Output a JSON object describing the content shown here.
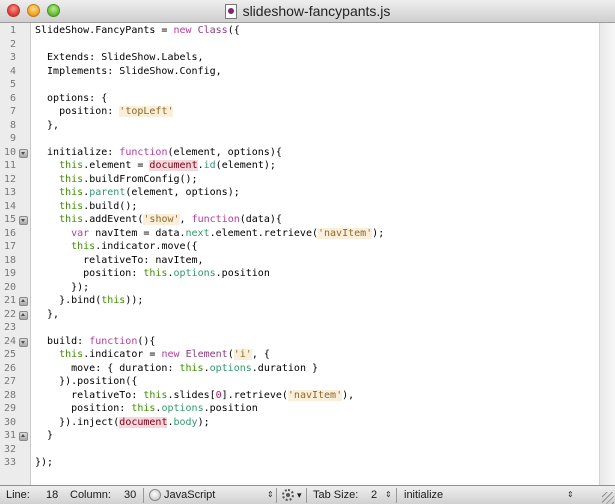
{
  "window": {
    "title": "slideshow-fancypants.js",
    "icon": "javascript-file-icon"
  },
  "editor": {
    "line_numbers": [
      "1",
      "2",
      "3",
      "4",
      "5",
      "6",
      "7",
      "8",
      "9",
      "10",
      "11",
      "12",
      "13",
      "14",
      "15",
      "16",
      "17",
      "18",
      "19",
      "20",
      "21",
      "22",
      "23",
      "24",
      "25",
      "26",
      "27",
      "28",
      "29",
      "30",
      "31",
      "32",
      "33"
    ],
    "fold_markers": [
      {
        "line": "10",
        "direction": "down"
      },
      {
        "line": "15",
        "direction": "down"
      },
      {
        "line": "21",
        "direction": "up"
      },
      {
        "line": "22",
        "direction": "up"
      },
      {
        "line": "24",
        "direction": "down"
      },
      {
        "line": "31",
        "direction": "up"
      }
    ],
    "lines": [
      [
        [
          "SlideShow.FancyPants = ",
          ""
        ],
        [
          "new",
          "kw"
        ],
        [
          " ",
          ""
        ],
        [
          "Class",
          "cls"
        ],
        [
          "({",
          ""
        ]
      ],
      [],
      [
        [
          "  Extends: SlideShow.Labels,",
          ""
        ]
      ],
      [
        [
          "  Implements: SlideShow.Config,",
          ""
        ]
      ],
      [],
      [
        [
          "  options: {",
          ""
        ]
      ],
      [
        [
          "    position: ",
          ""
        ],
        [
          "'topLeft'",
          "str"
        ]
      ],
      [
        [
          "  },",
          ""
        ]
      ],
      [],
      [
        [
          "  initialize: ",
          ""
        ],
        [
          "function",
          "kw"
        ],
        [
          "(element, options){",
          ""
        ]
      ],
      [
        [
          "    ",
          ""
        ],
        [
          "this",
          "this"
        ],
        [
          ".element = ",
          ""
        ],
        [
          "document",
          "glob"
        ],
        [
          ".",
          ""
        ],
        [
          "id",
          "prop"
        ],
        [
          "(element);",
          ""
        ]
      ],
      [
        [
          "    ",
          ""
        ],
        [
          "this",
          "this"
        ],
        [
          ".buildFromConfig();",
          ""
        ]
      ],
      [
        [
          "    ",
          ""
        ],
        [
          "this",
          "this"
        ],
        [
          ".",
          ""
        ],
        [
          "parent",
          "prop"
        ],
        [
          "(element, options);",
          ""
        ]
      ],
      [
        [
          "    ",
          ""
        ],
        [
          "this",
          "this"
        ],
        [
          ".build();",
          ""
        ]
      ],
      [
        [
          "    ",
          ""
        ],
        [
          "this",
          "this"
        ],
        [
          ".addEvent(",
          ""
        ],
        [
          "'show'",
          "str"
        ],
        [
          ", ",
          ""
        ],
        [
          "function",
          "kw"
        ],
        [
          "(data){",
          ""
        ]
      ],
      [
        [
          "      ",
          ""
        ],
        [
          "var",
          "kw"
        ],
        [
          " navItem = data.",
          ""
        ],
        [
          "next",
          "prop"
        ],
        [
          ".element.retrieve(",
          ""
        ],
        [
          "'navItem'",
          "str"
        ],
        [
          ");",
          ""
        ]
      ],
      [
        [
          "      ",
          ""
        ],
        [
          "this",
          "this"
        ],
        [
          ".indicator.move({",
          ""
        ]
      ],
      [
        [
          "        relativeTo: navItem,",
          ""
        ]
      ],
      [
        [
          "        position: ",
          ""
        ],
        [
          "this",
          "this"
        ],
        [
          ".",
          ""
        ],
        [
          "options",
          "prop"
        ],
        [
          ".position",
          ""
        ]
      ],
      [
        [
          "      });",
          ""
        ]
      ],
      [
        [
          "    }.bind(",
          ""
        ],
        [
          "this",
          "this"
        ],
        [
          "));",
          ""
        ]
      ],
      [
        [
          "  },",
          ""
        ]
      ],
      [],
      [
        [
          "  build: ",
          ""
        ],
        [
          "function",
          "kw"
        ],
        [
          "(){",
          ""
        ]
      ],
      [
        [
          "    ",
          ""
        ],
        [
          "this",
          "this"
        ],
        [
          ".indicator = ",
          ""
        ],
        [
          "new",
          "kw"
        ],
        [
          " ",
          ""
        ],
        [
          "Element",
          "cls"
        ],
        [
          "(",
          ""
        ],
        [
          "'i'",
          "str"
        ],
        [
          ", {",
          ""
        ]
      ],
      [
        [
          "      move: { duration: ",
          ""
        ],
        [
          "this",
          "this"
        ],
        [
          ".",
          ""
        ],
        [
          "options",
          "prop"
        ],
        [
          ".duration }",
          ""
        ]
      ],
      [
        [
          "    }).position({",
          ""
        ]
      ],
      [
        [
          "      relativeTo: ",
          ""
        ],
        [
          "this",
          "this"
        ],
        [
          ".slides[",
          ""
        ],
        [
          "0",
          "num"
        ],
        [
          "].retrieve(",
          ""
        ],
        [
          "'navItem'",
          "str"
        ],
        [
          "),",
          ""
        ]
      ],
      [
        [
          "      position: ",
          ""
        ],
        [
          "this",
          "this"
        ],
        [
          ".",
          ""
        ],
        [
          "options",
          "prop"
        ],
        [
          ".position",
          ""
        ]
      ],
      [
        [
          "    }).inject(",
          ""
        ],
        [
          "document",
          "glob"
        ],
        [
          ".",
          ""
        ],
        [
          "body",
          "prop"
        ],
        [
          ");",
          ""
        ]
      ],
      [
        [
          "  }",
          ""
        ]
      ],
      [],
      [
        [
          "});",
          ""
        ]
      ]
    ],
    "colors": {
      "keyword": "#b43ba2",
      "this": "#3e8e00",
      "property": "#2f9a6e",
      "string": "#8a6a25",
      "global": "#7a0017"
    }
  },
  "statusbar": {
    "line_label": "Line:",
    "line_value": "18",
    "column_label": "Column:",
    "column_value": "30",
    "language": "JavaScript",
    "tab_size_label": "Tab Size:",
    "tab_size_value": "2",
    "symbol": "initialize",
    "language_icon": "language-bubble-icon",
    "gear_icon": "gear-icon",
    "updown_glyph": "⇕"
  }
}
